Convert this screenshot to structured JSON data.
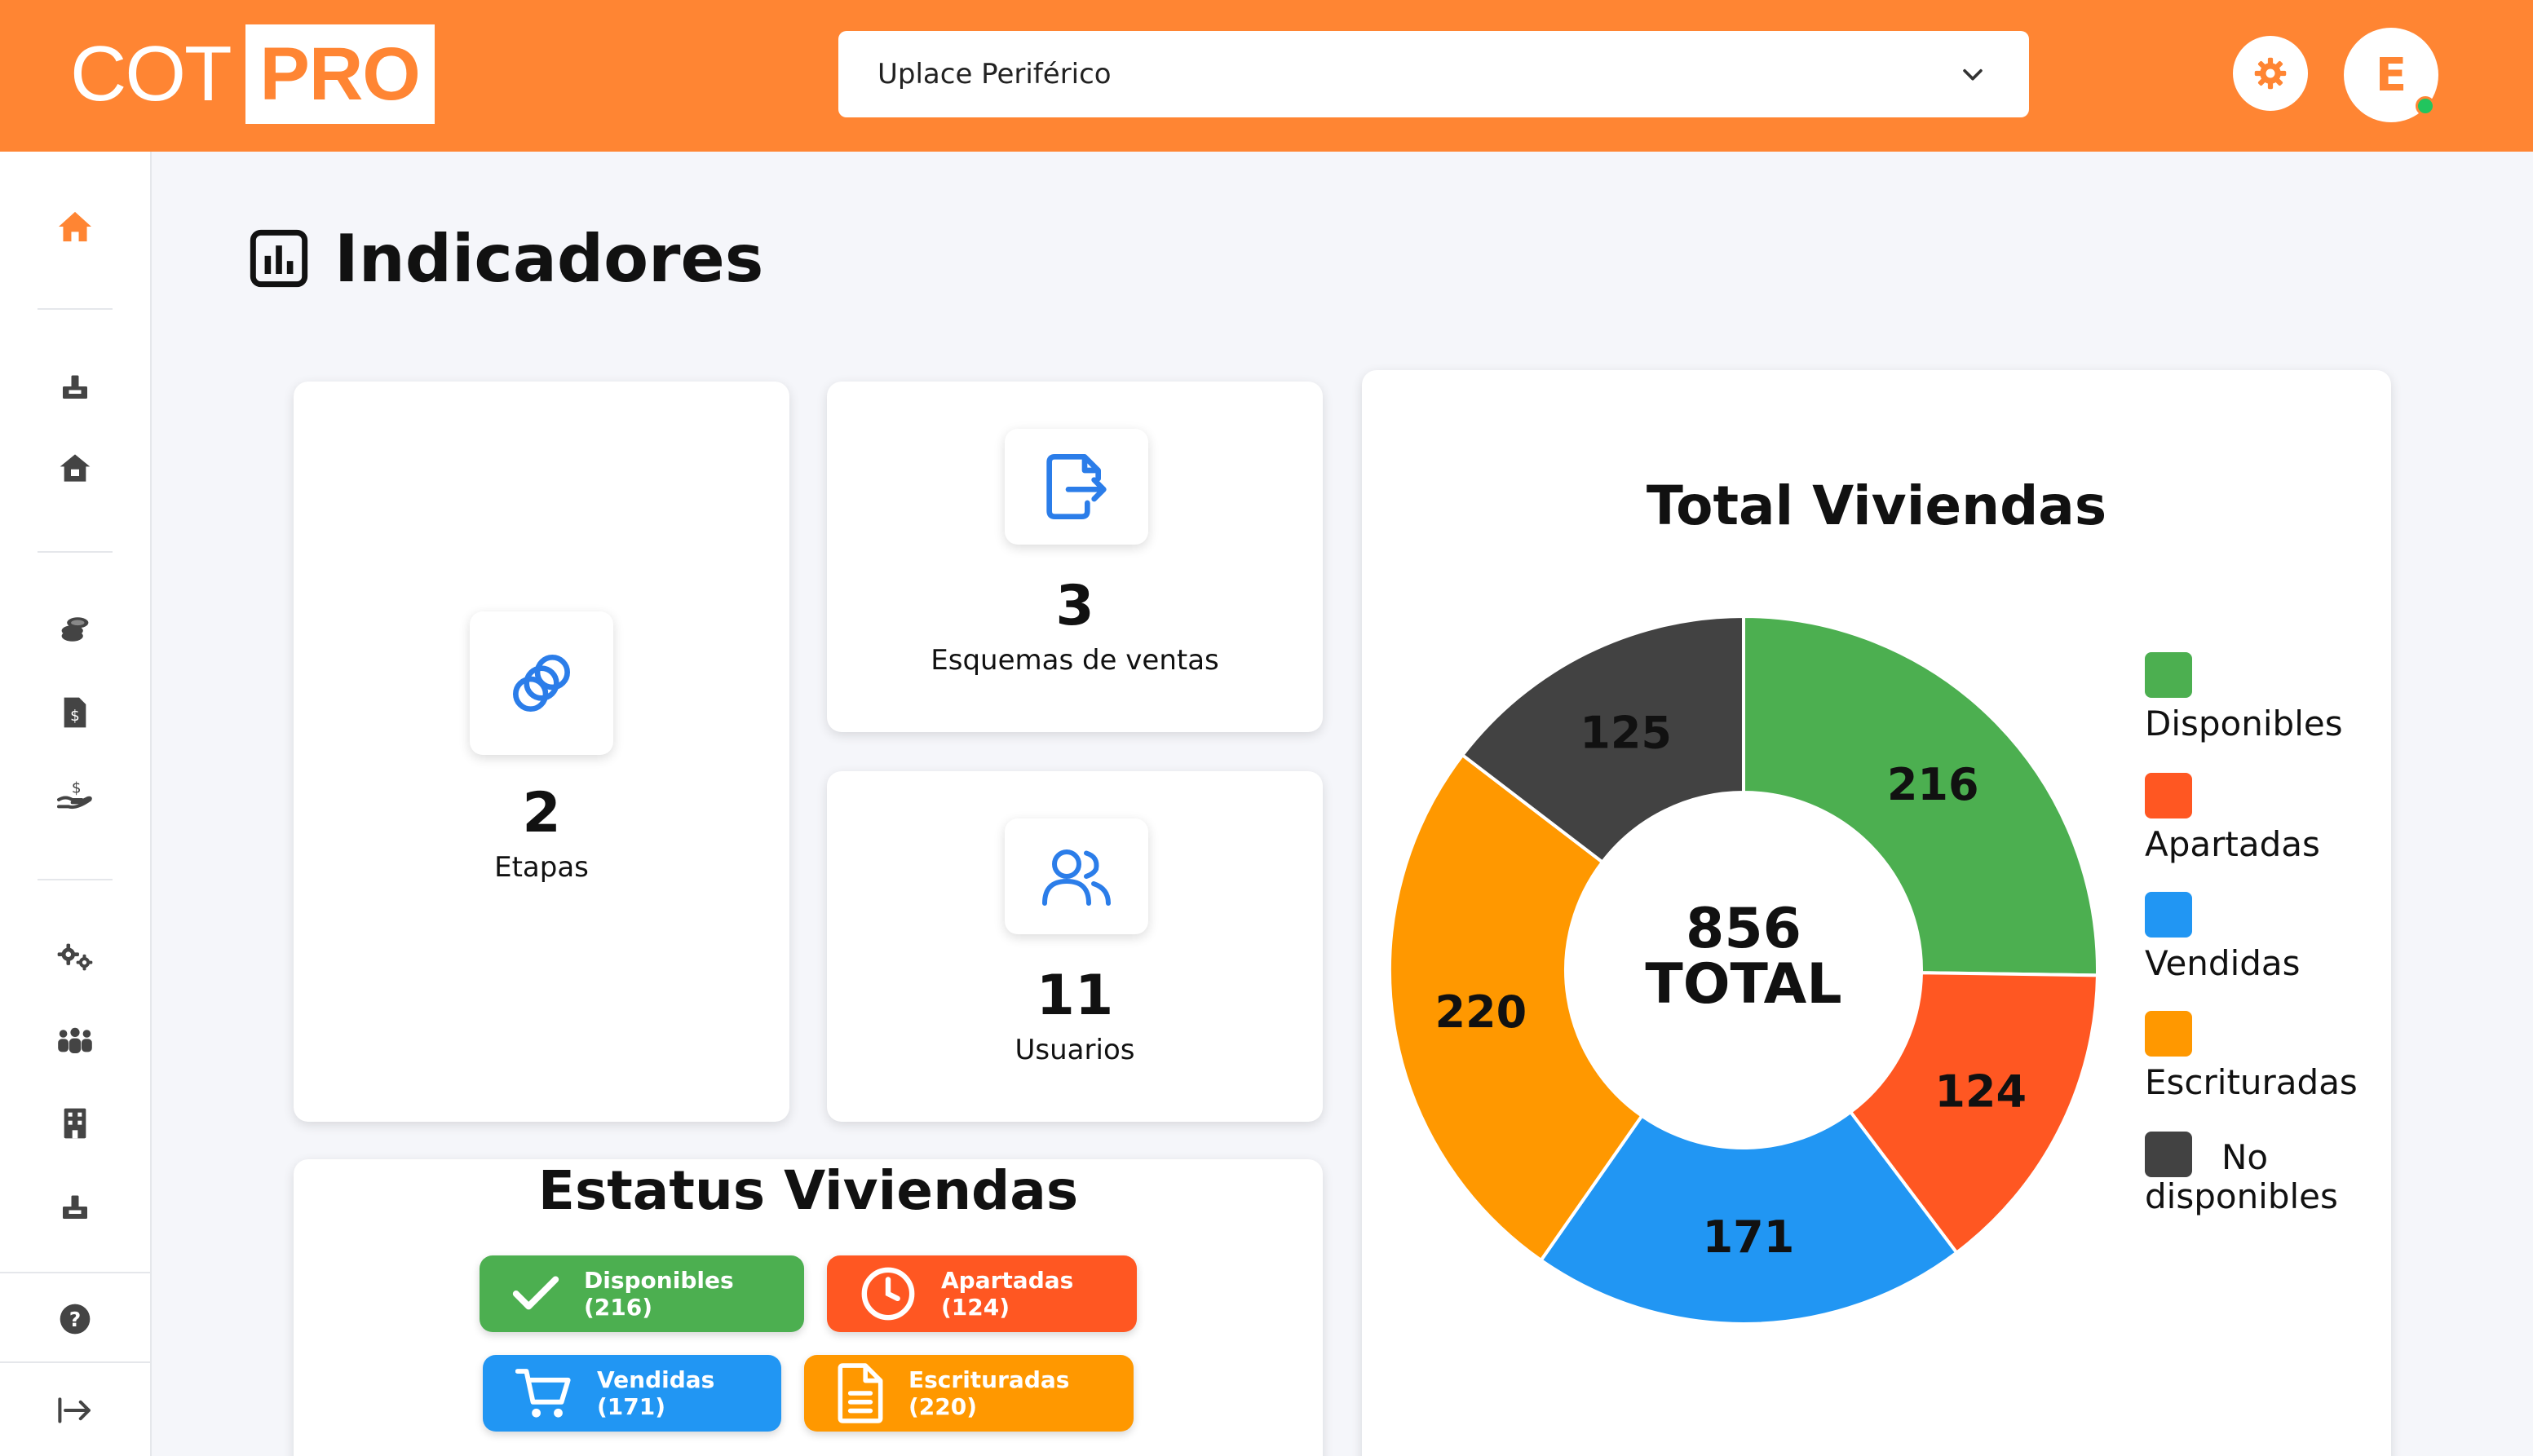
{
  "header": {
    "logo_left": "COT",
    "logo_right": "PRO",
    "project": "Uplace Periférico",
    "avatar_initial": "E"
  },
  "page": {
    "title": "Indicadores"
  },
  "kpis": {
    "etapas": {
      "value": "2",
      "label": "Etapas"
    },
    "esquemas": {
      "value": "3",
      "label": "Esquemas de ventas"
    },
    "usuarios": {
      "value": "11",
      "label": "Usuarios"
    }
  },
  "status": {
    "title": "Estatus Viviendas",
    "disponibles": "Disponibles (216)",
    "apartadas": "Apartadas (124)",
    "vendidas": "Vendidas (171)",
    "escrituradas": "Escrituradas (220)"
  },
  "colors": {
    "brand": "#ff8533",
    "disponibles": "#4caf50",
    "apartadas": "#ff5722",
    "vendidas": "#2196f3",
    "escrituradas": "#ff9800",
    "no_disponibles": "#424242"
  },
  "chart_data": {
    "type": "pie",
    "title": "Total Viviendas",
    "center_value": "856",
    "center_label": "TOTAL",
    "categories": [
      "Disponibles",
      "Apartadas",
      "Vendidas",
      "Escrituradas",
      "No disponibles"
    ],
    "values": [
      216,
      124,
      171,
      220,
      125
    ],
    "colors": [
      "#4caf50",
      "#ff5722",
      "#2196f3",
      "#ff9800",
      "#424242"
    ],
    "legend_position": "right",
    "legend_no_disp_1": "No",
    "legend_no_disp_2": "disponibles"
  }
}
